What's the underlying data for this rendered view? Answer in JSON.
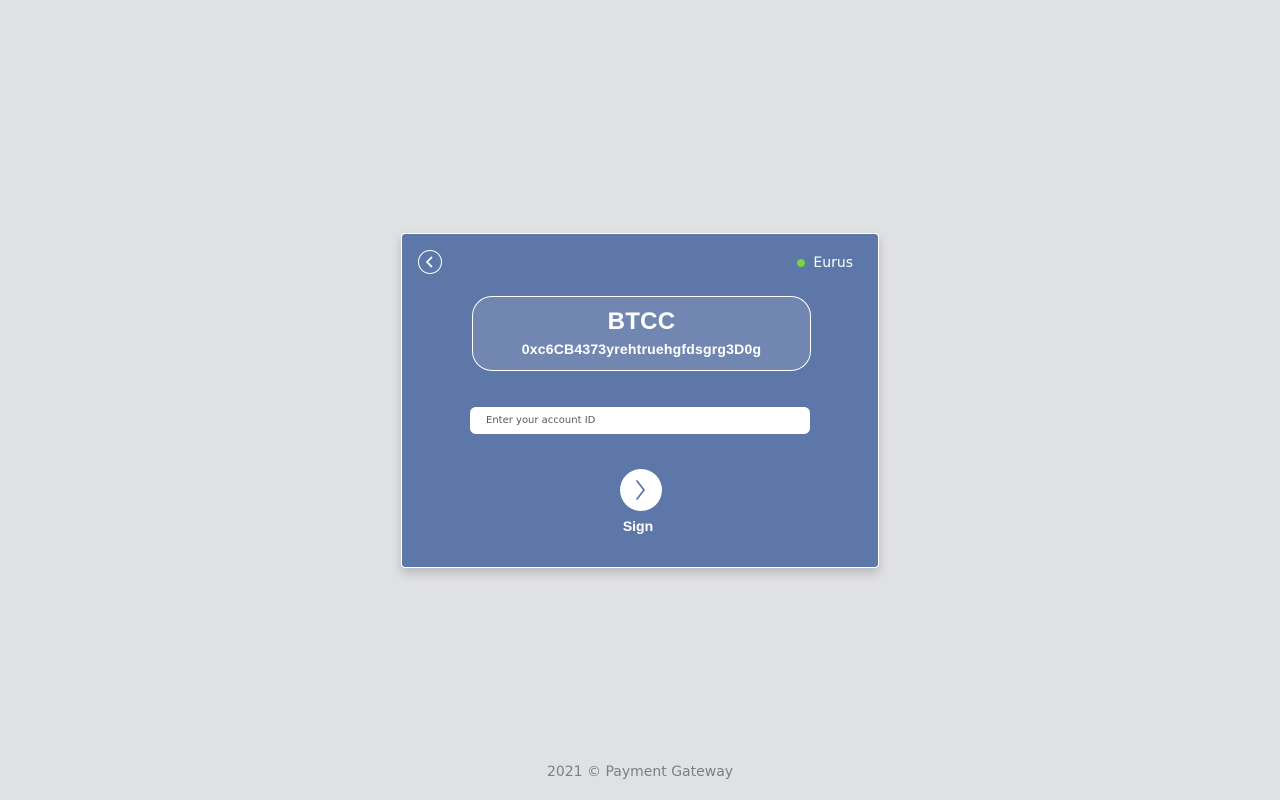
{
  "network": {
    "name": "Eurus",
    "status_color": "#7bd33d"
  },
  "token": {
    "symbol": "BTCC",
    "address": "0xc6CB4373yrehtruehgfdsgrg3D0g"
  },
  "account_input": {
    "placeholder": "Enter your account ID",
    "value": ""
  },
  "actions": {
    "back_icon": "chevron-left-circle-icon",
    "sign_icon": "chevron-right-icon",
    "sign_label": "Sign"
  },
  "footer": {
    "text": "2021 © Payment Gateway"
  },
  "colors": {
    "page_background": "#e0e1e3",
    "card_background": "#5d77a8",
    "token_box_background": "#7186b0",
    "accent": "#5d77a8"
  }
}
